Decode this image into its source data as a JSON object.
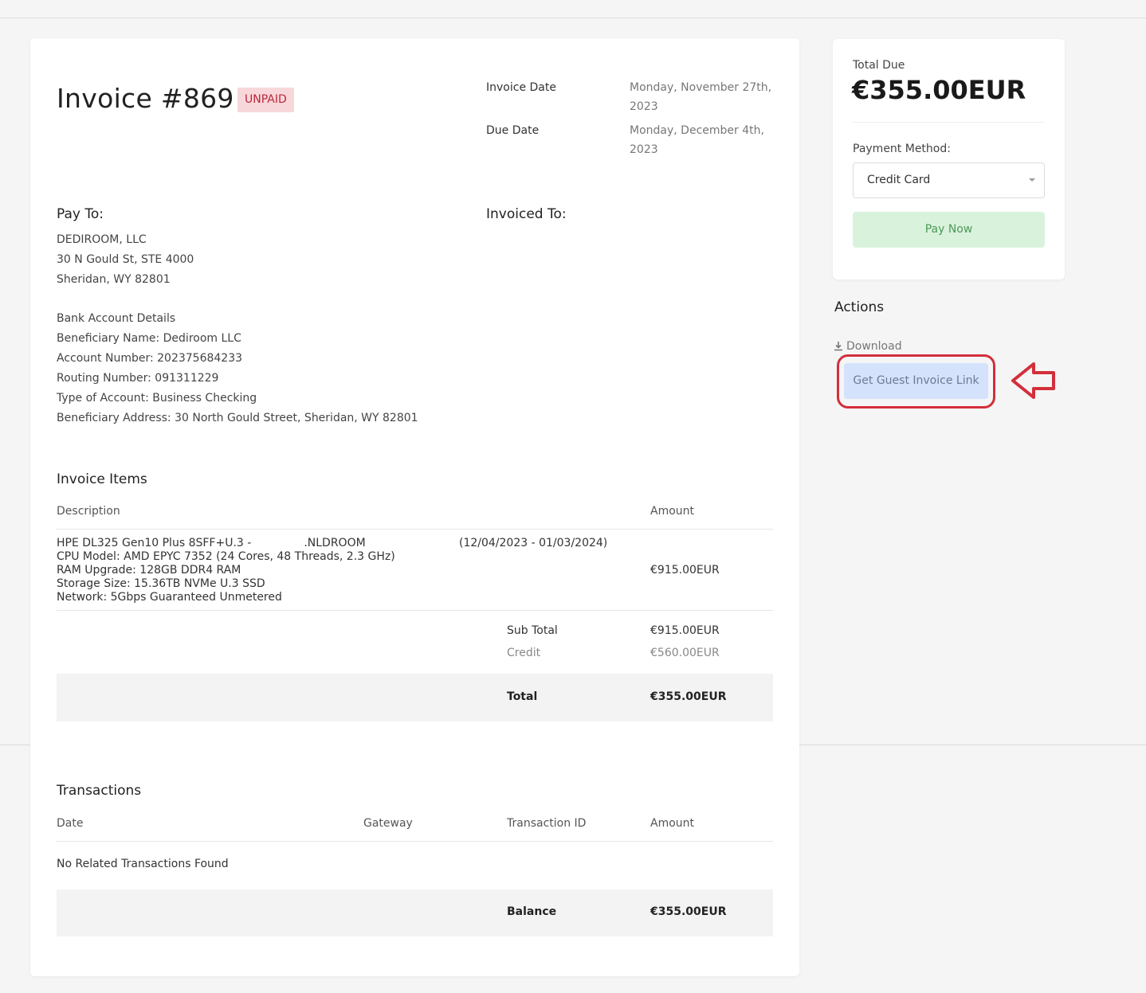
{
  "invoice": {
    "title": "Invoice #869",
    "status": "UNPAID",
    "invoice_date_label": "Invoice Date",
    "invoice_date": "Monday, November 27th, 2023",
    "due_date_label": "Due Date",
    "due_date": "Monday, December 4th, 2023"
  },
  "pay_to": {
    "heading": "Pay To:",
    "lines": [
      "DEDIROOM, LLC",
      "30 N Gould St, STE 4000",
      "Sheridan, WY 82801"
    ],
    "bank_lines": [
      "Bank Account Details",
      "Beneficiary Name: Dediroom LLC",
      "Account Number: 202375684233",
      "Routing Number: 091311229",
      "Type of Account: Business Checking",
      "Beneficiary Address: 30 North Gould Street, Sheridan, WY 82801"
    ]
  },
  "invoiced_to": {
    "heading": "Invoiced To:"
  },
  "items": {
    "heading": "Invoice Items",
    "col_description": "Description",
    "col_amount": "Amount",
    "rows": [
      {
        "desc_start": "HPE DL325 Gen10 Plus 8SFF+U.3 -",
        "desc_end": ".NLDROOM",
        "lines": [
          "CPU Model: AMD EPYC 7352 (24 Cores, 48 Threads, 2.3 GHz)",
          "RAM Upgrade: 128GB DDR4 RAM",
          "Storage Size: 15.36TB NVMe U.3 SSD",
          "Network: 5Gbps Guaranteed Unmetered"
        ],
        "period": "(12/04/2023 - 01/03/2024)",
        "amount": "€915.00EUR"
      }
    ],
    "subtotal_label": "Sub Total",
    "subtotal": "€915.00EUR",
    "credit_label": "Credit",
    "credit": "€560.00EUR",
    "total_label": "Total",
    "total": "€355.00EUR"
  },
  "transactions": {
    "heading": "Transactions",
    "col_date": "Date",
    "col_gateway": "Gateway",
    "col_txid": "Transaction ID",
    "col_amount": "Amount",
    "empty": "No Related Transactions Found",
    "balance_label": "Balance",
    "balance": "€355.00EUR"
  },
  "sidebar": {
    "total_due_label": "Total Due",
    "total_due": "€355.00EUR",
    "payment_method_label": "Payment Method:",
    "payment_method": "Credit Card",
    "pay_now": "Pay Now",
    "actions_heading": "Actions",
    "download": "Download",
    "guest_link": "Get Guest Invoice Link"
  },
  "colors": {
    "highlight": "#d32f3b",
    "unpaid_bg": "#f8d7da",
    "pay_now_bg": "#d9f2dc",
    "guest_btn_bg": "#d4e2fb"
  }
}
